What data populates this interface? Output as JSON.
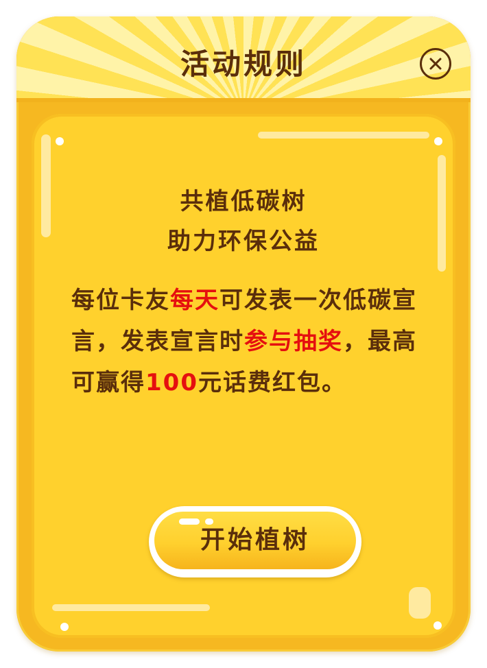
{
  "dialog": {
    "title": "活动规则",
    "close_icon": "close-icon"
  },
  "content": {
    "subtitle_line1": "共植低碳树",
    "subtitle_line2": "助力环保公益",
    "rules": {
      "seg1": "每位卡友",
      "seg2": "每天",
      "seg3": "可发表一次低碳宣言，发表宣言时",
      "seg4": "参与抽奖",
      "seg5": "，最高可赢得",
      "seg6": "100",
      "seg7": "元话费红包。"
    }
  },
  "actions": {
    "start_label": "开始植树"
  },
  "colors": {
    "text_brown": "#5a2e0b",
    "highlight_red": "#e50f0f",
    "panel_yellow": "#ffd12d",
    "frame_orange": "#f6b821"
  }
}
